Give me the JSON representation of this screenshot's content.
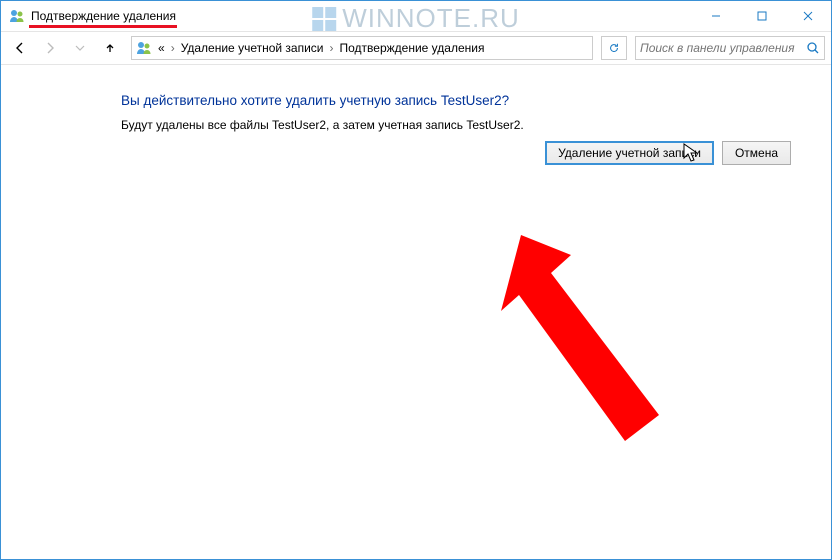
{
  "window": {
    "title": "Подтверждение удаления"
  },
  "watermark": {
    "text": "WINNOTE.RU"
  },
  "breadcrumb": {
    "item1": "Удаление учетной записи",
    "item2": "Подтверждение удаления"
  },
  "search": {
    "placeholder": "Поиск в панели управления"
  },
  "content": {
    "heading": "Вы действительно хотите удалить учетную запись TestUser2?",
    "body": "Будут удалены все файлы TestUser2, а затем учетная запись TestUser2."
  },
  "buttons": {
    "delete": "Удаление учетной записи",
    "cancel": "Отмена"
  }
}
